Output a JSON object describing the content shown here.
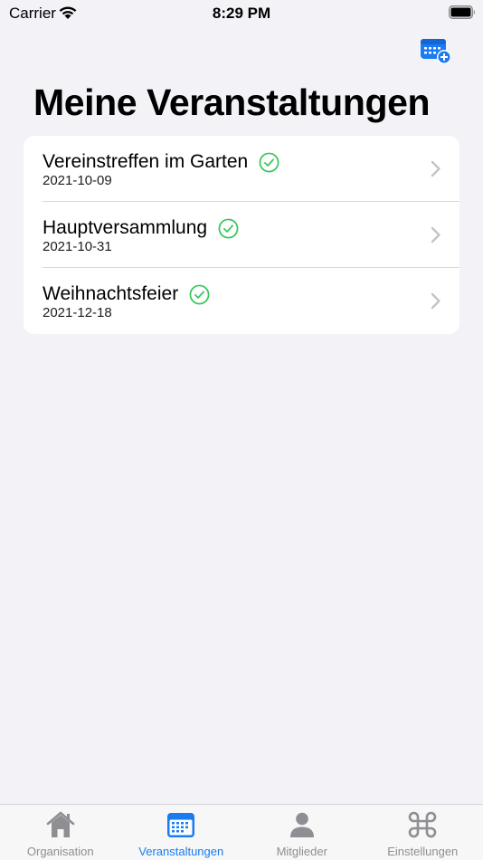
{
  "status_bar": {
    "carrier": "Carrier",
    "time": "8:29 PM"
  },
  "header": {
    "title": "Meine Veranstaltungen",
    "add_icon": "calendar-add-icon"
  },
  "events": [
    {
      "title": "Vereinstreffen im Garten",
      "date": "2021-10-09",
      "status_icon": "checkmark-circle-icon"
    },
    {
      "title": "Hauptversammlung",
      "date": "2021-10-31",
      "status_icon": "checkmark-circle-icon"
    },
    {
      "title": "Weihnachtsfeier",
      "date": "2021-12-18",
      "status_icon": "checkmark-circle-icon"
    }
  ],
  "tabs": [
    {
      "label": "Organisation",
      "icon": "house-icon",
      "active": false
    },
    {
      "label": "Veranstaltungen",
      "icon": "calendar-icon",
      "active": true
    },
    {
      "label": "Mitglieder",
      "icon": "person-icon",
      "active": false
    },
    {
      "label": "Einstellungen",
      "icon": "command-icon",
      "active": false
    }
  ],
  "colors": {
    "accent": "#1a7cf1",
    "check": "#34c759",
    "inactive": "#8e8e93",
    "background": "#f2f2f7"
  }
}
